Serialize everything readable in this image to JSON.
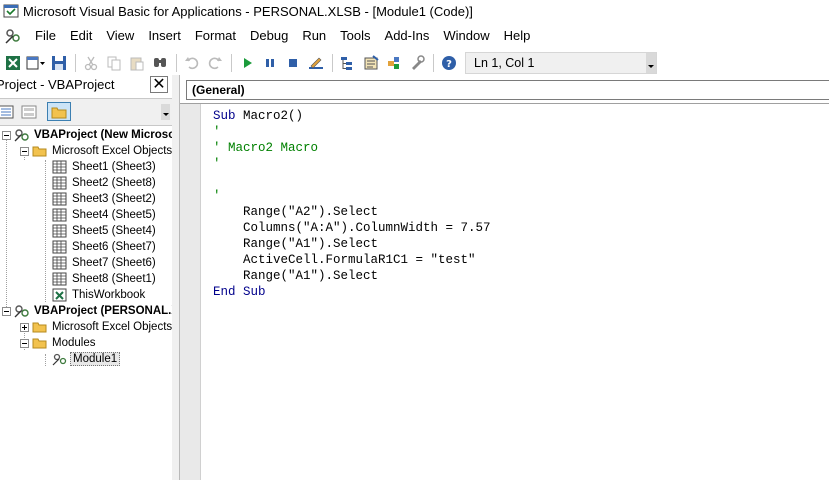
{
  "window": {
    "title": "Microsoft Visual Basic for Applications - PERSONAL.XLSB - [Module1 (Code)]"
  },
  "menu": {
    "items": [
      "File",
      "Edit",
      "View",
      "Insert",
      "Format",
      "Debug",
      "Run",
      "Tools",
      "Add-Ins",
      "Window",
      "Help"
    ]
  },
  "toolbar": {
    "status": "Ln 1, Col 1",
    "icons": [
      "excel-icon",
      "insert-module-icon",
      "save-icon",
      "cut-icon",
      "copy-icon",
      "paste-icon",
      "find-icon",
      "undo-icon",
      "redo-icon",
      "run-icon",
      "break-icon",
      "reset-icon",
      "design-mode-icon",
      "project-explorer-icon",
      "properties-icon",
      "object-browser-icon",
      "toolbox-icon",
      "help-icon"
    ]
  },
  "project_panel": {
    "title": "Project - VBAProject",
    "close_glyph": "✕",
    "tree": [
      {
        "label": "VBAProject (New Microsoft Excel Worksheet.xlsx)",
        "bold": true
      },
      {
        "label": "Microsoft Excel Objects"
      },
      {
        "label": "Sheet1 (Sheet3)"
      },
      {
        "label": "Sheet2 (Sheet8)"
      },
      {
        "label": "Sheet3 (Sheet2)"
      },
      {
        "label": "Sheet4 (Sheet5)"
      },
      {
        "label": "Sheet5 (Sheet4)"
      },
      {
        "label": "Sheet6 (Sheet7)"
      },
      {
        "label": "Sheet7 (Sheet6)"
      },
      {
        "label": "Sheet8 (Sheet1)"
      },
      {
        "label": "ThisWorkbook"
      },
      {
        "label": "VBAProject (PERSONAL.XLSB)",
        "bold": true
      },
      {
        "label": "Microsoft Excel Objects"
      },
      {
        "label": "Modules"
      },
      {
        "label": "Module1",
        "selected": true
      }
    ]
  },
  "code_window": {
    "object_dropdown": "(General)",
    "lines": [
      {
        "text": "Sub Macro2()",
        "type": "code"
      },
      {
        "text": "'",
        "type": "comment"
      },
      {
        "text": "' Macro2 Macro",
        "type": "comment"
      },
      {
        "text": "'",
        "type": "comment"
      },
      {
        "text": "",
        "type": "code"
      },
      {
        "text": "'",
        "type": "comment"
      },
      {
        "text": "    Range(\"A2\").Select",
        "type": "code"
      },
      {
        "text": "    Columns(\"A:A\").ColumnWidth = 7.57",
        "type": "code"
      },
      {
        "text": "    Range(\"A1\").Select",
        "type": "code"
      },
      {
        "text": "    ActiveCell.FormulaR1C1 = \"test\"",
        "type": "code"
      },
      {
        "text": "    Range(\"A1\").Select",
        "type": "code"
      },
      {
        "text": "End Sub",
        "type": "code"
      }
    ]
  }
}
